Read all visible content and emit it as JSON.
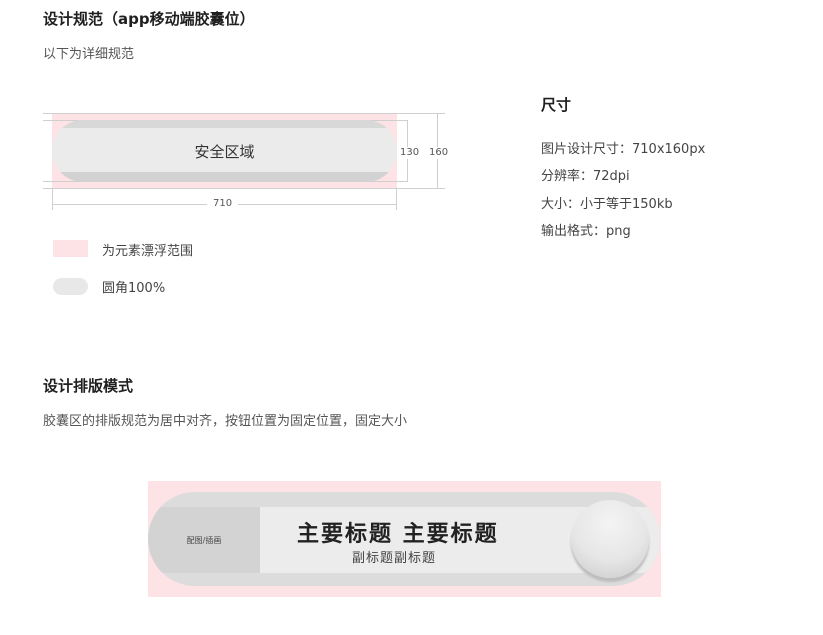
{
  "section1": {
    "title": "设计规范（app移动端胶囊位）",
    "desc": "以下为详细规范"
  },
  "diagram": {
    "safe_area_label": "安全区域",
    "width_label": "710",
    "inner_height_label": "130",
    "outer_height_label": "160"
  },
  "legend": [
    {
      "label": "为元素漂浮范围",
      "color": "#fde3e5"
    },
    {
      "label": "圆角100%",
      "color": "#e8e8e8"
    }
  ],
  "size_spec": {
    "title": "尺寸",
    "lines": [
      "图片设计尺寸：710x160px",
      "分辨率：72dpi",
      "大小：小于等于150kb",
      "输出格式：png"
    ]
  },
  "section2": {
    "title": "设计排版模式",
    "desc": "胶囊区的排版规范为居中对齐，按钮位置为固定位置，固定大小"
  },
  "demo": {
    "pic_label": "配图/插画",
    "main_title": "主要标题 主要标题",
    "sub_title": "副标题副标题"
  }
}
